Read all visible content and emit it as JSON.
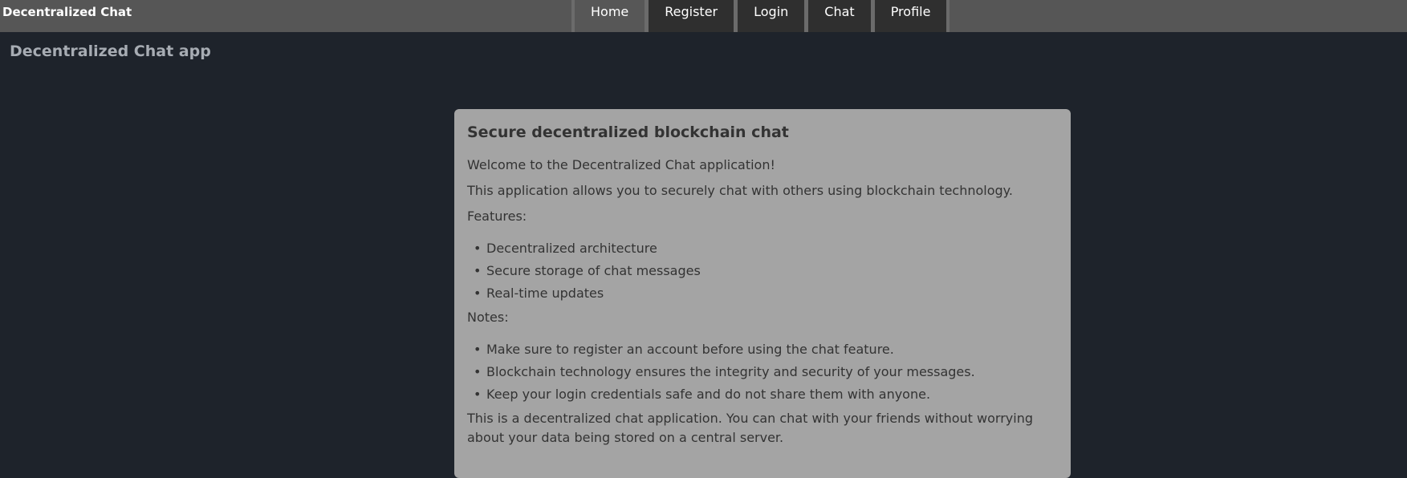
{
  "header": {
    "brand": "Decentralized Chat",
    "nav": [
      "Home",
      "Register",
      "Login",
      "Chat",
      "Profile"
    ],
    "active_index": 0
  },
  "page": {
    "app_title": "Decentralized Chat app"
  },
  "card": {
    "heading": "Secure decentralized blockchain chat",
    "welcome": "Welcome to the Decentralized Chat application!",
    "intro": "This application allows you to securely chat with others using blockchain technology.",
    "features_label": "Features:",
    "features": [
      "Decentralized architecture",
      "Secure storage of chat messages",
      "Real-time updates"
    ],
    "notes_label": "Notes:",
    "notes": [
      "Make sure to register an account before using the chat feature.",
      "Blockchain technology ensures the integrity and security of your messages.",
      "Keep your login credentials safe and do not share them with anyone."
    ],
    "footer": "This is a decentralized chat application. You can chat with your friends without worrying about your data being stored on a central server."
  }
}
